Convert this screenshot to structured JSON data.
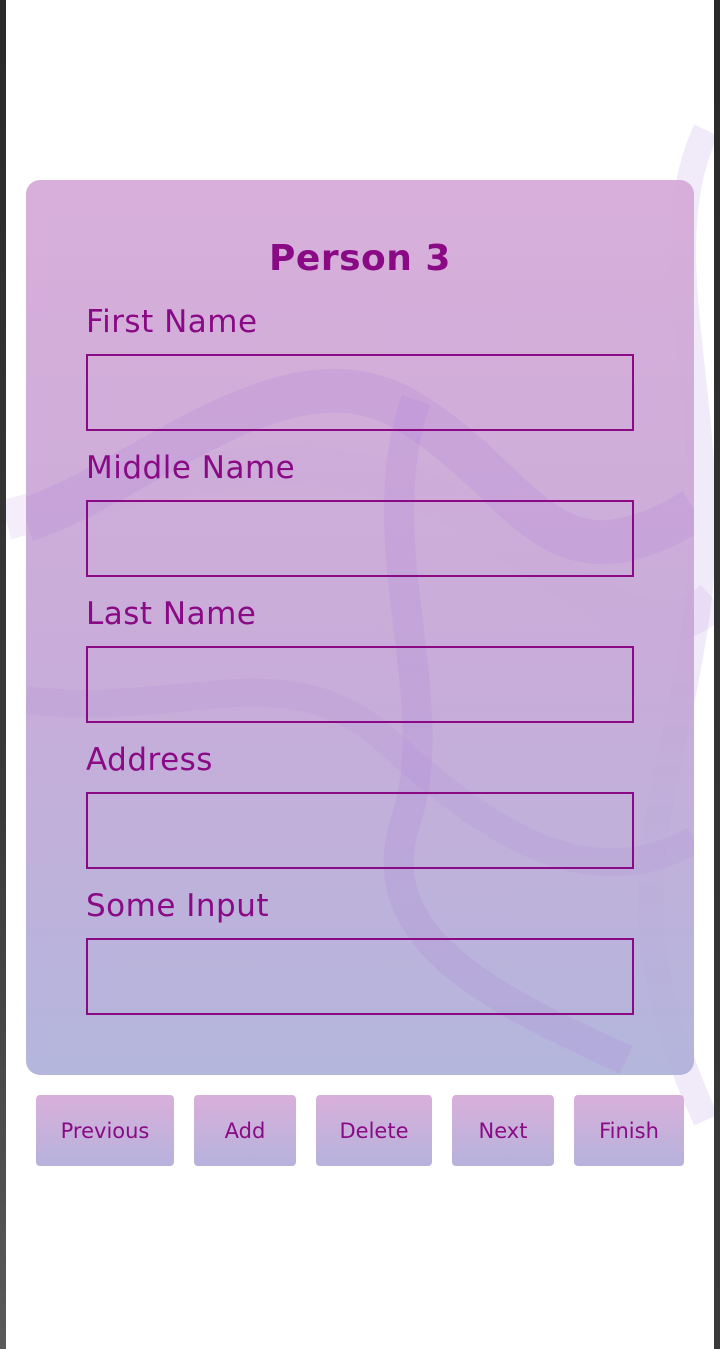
{
  "form": {
    "title": "Person 3",
    "fields": [
      {
        "label": "First Name",
        "value": ""
      },
      {
        "label": "Middle Name",
        "value": ""
      },
      {
        "label": "Last Name",
        "value": ""
      },
      {
        "label": "Address",
        "value": ""
      },
      {
        "label": "Some Input",
        "value": ""
      }
    ]
  },
  "buttons": {
    "previous": "Previous",
    "add": "Add",
    "delete": "Delete",
    "next": "Next",
    "finish": "Finish"
  },
  "colors": {
    "accent": "#8a0a86",
    "card_top": "#d6acd8",
    "card_bottom": "#b0b2da"
  }
}
